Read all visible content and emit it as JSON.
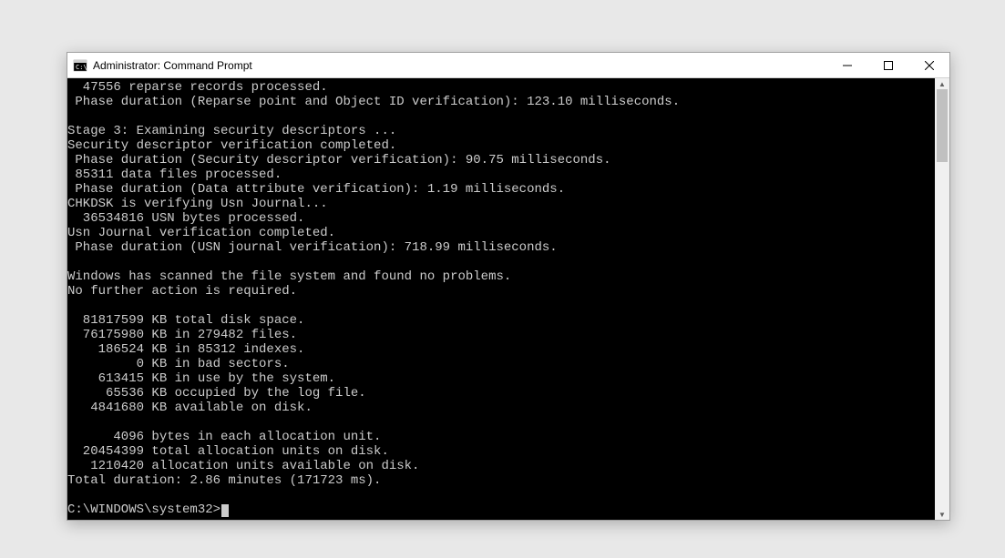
{
  "window": {
    "title": "Administrator: Command Prompt"
  },
  "terminal": {
    "lines": [
      "  47556 reparse records processed.",
      " Phase duration (Reparse point and Object ID verification): 123.10 milliseconds.",
      "",
      "Stage 3: Examining security descriptors ...",
      "Security descriptor verification completed.",
      " Phase duration (Security descriptor verification): 90.75 milliseconds.",
      " 85311 data files processed.",
      " Phase duration (Data attribute verification): 1.19 milliseconds.",
      "CHKDSK is verifying Usn Journal...",
      "  36534816 USN bytes processed.",
      "Usn Journal verification completed.",
      " Phase duration (USN journal verification): 718.99 milliseconds.",
      "",
      "Windows has scanned the file system and found no problems.",
      "No further action is required.",
      "",
      "  81817599 KB total disk space.",
      "  76175980 KB in 279482 files.",
      "    186524 KB in 85312 indexes.",
      "         0 KB in bad sectors.",
      "    613415 KB in use by the system.",
      "     65536 KB occupied by the log file.",
      "   4841680 KB available on disk.",
      "",
      "      4096 bytes in each allocation unit.",
      "  20454399 total allocation units on disk.",
      "   1210420 allocation units available on disk.",
      "Total duration: 2.86 minutes (171723 ms).",
      ""
    ],
    "prompt": "C:\\WINDOWS\\system32>"
  }
}
